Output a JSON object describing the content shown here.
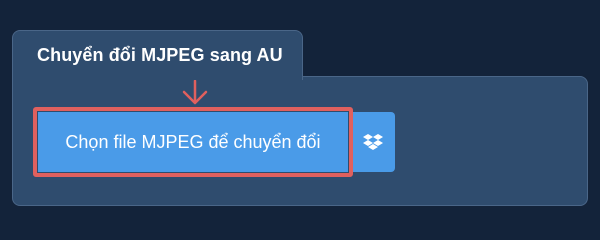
{
  "converter": {
    "tab_title": "Chuyển đổi MJPEG sang AU",
    "choose_file_label": "Chọn file MJPEG để chuyển đổi",
    "dropbox_icon": "dropbox-icon",
    "hint_icon": "arrow-down-icon"
  },
  "colors": {
    "background": "#13233a",
    "panel": "#2f4c6e",
    "button": "#4a9be8",
    "highlight": "#e0605e"
  }
}
